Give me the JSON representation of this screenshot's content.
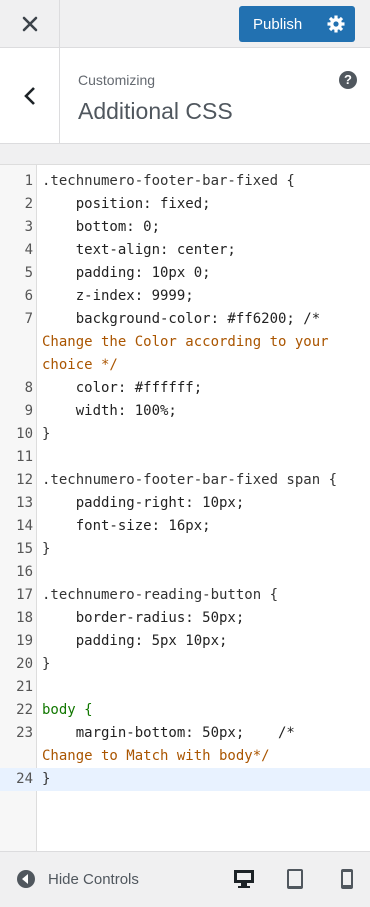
{
  "topbar": {
    "publish_label": "Publish"
  },
  "header": {
    "eyebrow": "Customizing",
    "title": "Additional CSS",
    "help": "?"
  },
  "editor": {
    "lines": [
      {
        "n": "1",
        "t": ".technumero-footer-bar-fixed {"
      },
      {
        "n": "2",
        "t": "    position: fixed;"
      },
      {
        "n": "3",
        "t": "    bottom: 0;"
      },
      {
        "n": "4",
        "t": "    text-align: center;"
      },
      {
        "n": "5",
        "t": "    padding: 10px 0;"
      },
      {
        "n": "6",
        "t": "    z-index: 9999;"
      },
      {
        "n": "7",
        "t": "    background-color: #ff6200; /*"
      },
      {
        "n": "",
        "t": "Change the Color according to your"
      },
      {
        "n": "",
        "t": "choice */"
      },
      {
        "n": "8",
        "t": "    color: #ffffff;"
      },
      {
        "n": "9",
        "t": "    width: 100%;"
      },
      {
        "n": "10",
        "t": "}"
      },
      {
        "n": "11",
        "t": ""
      },
      {
        "n": "12",
        "t": ".technumero-footer-bar-fixed span {"
      },
      {
        "n": "13",
        "t": "    padding-right: 10px;"
      },
      {
        "n": "14",
        "t": "    font-size: 16px;"
      },
      {
        "n": "15",
        "t": "}"
      },
      {
        "n": "16",
        "t": ""
      },
      {
        "n": "17",
        "t": ".technumero-reading-button {"
      },
      {
        "n": "18",
        "t": "    border-radius: 50px;"
      },
      {
        "n": "19",
        "t": "    padding: 5px 10px;"
      },
      {
        "n": "20",
        "t": "}"
      },
      {
        "n": "21",
        "t": ""
      },
      {
        "n": "22",
        "t": "body {"
      },
      {
        "n": "23",
        "t": "    margin-bottom: 50px;    /*"
      },
      {
        "n": "",
        "t": "Change to Match with body*/"
      },
      {
        "n": "24",
        "t": "}"
      }
    ]
  },
  "footer": {
    "hide_label": "Hide Controls"
  },
  "colors": {
    "accent": "#2271b1",
    "grammarly": "#15c39a"
  }
}
